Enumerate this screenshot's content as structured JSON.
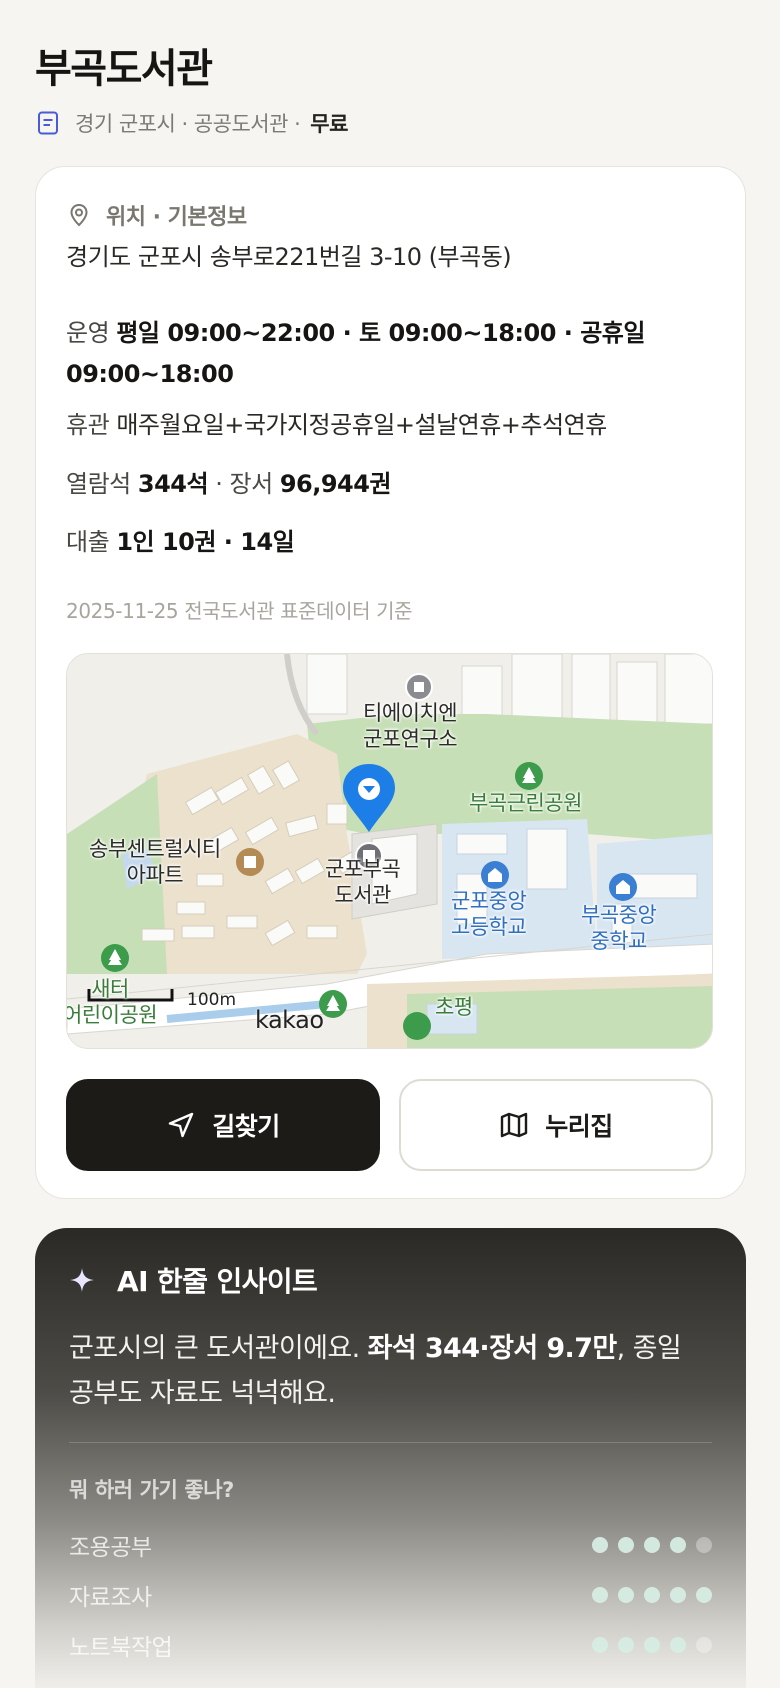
{
  "header": {
    "title": "부곡도서관",
    "subtitle": "경기 군포시 · 공공도서관 ·",
    "fee": "무료"
  },
  "info": {
    "section_title": "위치 · 기본정보",
    "address": "경기도 군포시 송부로221번길 3-10 (부곡동)",
    "hours_label": "운영",
    "hours_value": "평일 09:00~22:00 · 토 09:00~18:00 · 공휴일 09:00~18:00",
    "closed_label": "휴관",
    "closed_value": "매주월요일+국가지정공휴일+설날연휴+추석연휴",
    "seats_label": "열람석",
    "seats_value": "344석",
    "books_label": "장서",
    "books_value": "96,944권",
    "loan_label": "대출",
    "loan_value": "1인 10권 · 14일",
    "data_date": "2025-11-25 전국도서관 표준데이터 기준"
  },
  "map": {
    "labels": {
      "research": "티에이치엔\n군포연구소",
      "park": "부곡근린공원",
      "apartment": "송부센트럴시티\n아파트",
      "library": "군포부곡\n도서관",
      "high_school": "군포중앙\n고등학교",
      "middle_school": "부곡중앙\n중학교",
      "kids_park": "새터\n어린이공원",
      "chopyeong": "초평"
    },
    "scale": "100m",
    "provider": "kakao"
  },
  "actions": {
    "directions": "길찾기",
    "nurijip": "누리집"
  },
  "ai": {
    "title": "AI 한줄 인사이트",
    "text_pre": "군포시의 큰 도서관이에요. ",
    "text_bold": "좌석 344·장서 9.7만",
    "text_post": ", 종일 공부도 자료도 넉넉해요.",
    "question": "뭐 하러 가기 좋나?",
    "purposes": [
      {
        "label": "조용공부",
        "score": 4,
        "max": 5
      },
      {
        "label": "자료조사",
        "score": 5,
        "max": 5
      },
      {
        "label": "노트북작업",
        "score": 4,
        "max": 5
      }
    ]
  },
  "colors": {
    "background": "#f6f5f1",
    "primary_button": "#1c1b18",
    "pin": "#1e7ee8",
    "dot_on": "#d6ede4"
  },
  "icons": {
    "subtitle": "document-icon",
    "section": "location-pin-icon",
    "directions": "navigation-arrow-icon",
    "nurijip": "map-icon",
    "ai": "sparkle-icon"
  }
}
